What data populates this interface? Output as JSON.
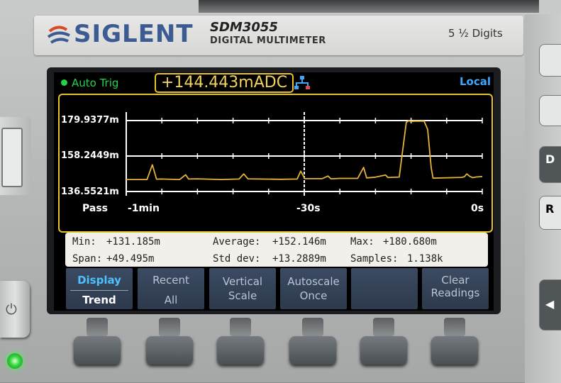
{
  "brand": {
    "logo": "SIGLENT",
    "model": "SDM3055",
    "model_sub": "DIGITAL MULTIMETER",
    "digits": "5 ½ Digits"
  },
  "status": {
    "trigger": "Auto Trig",
    "reading": "+144.443mADC",
    "remote": "Local",
    "trigger_color": "#23d34b",
    "reading_color": "#f2d15a",
    "remote_color": "#3ba7ff"
  },
  "chart_data": {
    "type": "line",
    "ylim": [
      136.5521,
      179.9377
    ],
    "yticks": [
      "179.9377m",
      "158.2449m",
      "136.5521m"
    ],
    "xlabel_left": "Pass",
    "xticks": [
      "-1min",
      "-30s",
      "0s"
    ],
    "series": [
      {
        "color": "#e6b23a",
        "x": [
          -60,
          -56.5,
          -55.6,
          -54.9,
          -54.2,
          -51,
          -50,
          -49.5,
          -48,
          -44,
          -41,
          -40.2,
          -39.5,
          -34,
          -31.2,
          -30.6,
          -29.9,
          -27,
          -26,
          -25.5,
          -24,
          -23,
          -21,
          -20,
          -19.5,
          -18,
          -16.3,
          -15.9,
          -15.5,
          -14,
          -12.8,
          -12.4,
          -12,
          -11.3,
          -9.8,
          -9.2,
          -8.6,
          -8.3,
          -3.5,
          -3,
          -2.6,
          -2.1,
          -1.6,
          -1.1,
          0
        ],
        "values": [
          143.9,
          143.9,
          152.9,
          144.1,
          144.2,
          143.9,
          146.8,
          144.2,
          144.3,
          143.9,
          144.2,
          147.3,
          144.3,
          144.0,
          144.2,
          149.0,
          144.4,
          144.4,
          146.0,
          144.3,
          144.6,
          144.6,
          144.6,
          151.3,
          144.9,
          145.3,
          146.6,
          145.1,
          145.2,
          145.4,
          178.9,
          179.8,
          179.4,
          179.6,
          179.6,
          174.5,
          151.0,
          144.7,
          145.2,
          145.6,
          147.3,
          145.8,
          145.0,
          145.4,
          145.7
        ]
      }
    ]
  },
  "stats": {
    "min_label": "Min:",
    "min": "+131.185m",
    "avg_label": "Average:",
    "avg": "+152.146m",
    "max_label": "Max:",
    "max": "+180.680m",
    "span_label": "Span:",
    "span": "+49.495m",
    "std_label": "Std dev:",
    "std": "+13.2889m",
    "samples_label": "Samples:",
    "samples": "1.138k"
  },
  "softkeys": [
    {
      "line1": "Display",
      "line2": "Trend",
      "active": true
    },
    {
      "line1": "Recent",
      "line2": "All"
    },
    {
      "line1": "Vertical",
      "line2": "Scale"
    },
    {
      "line1": "Autoscale",
      "line2": "Once"
    },
    {
      "line1": "",
      "line2": ""
    },
    {
      "line1": "Clear",
      "line2": "Readings"
    }
  ]
}
